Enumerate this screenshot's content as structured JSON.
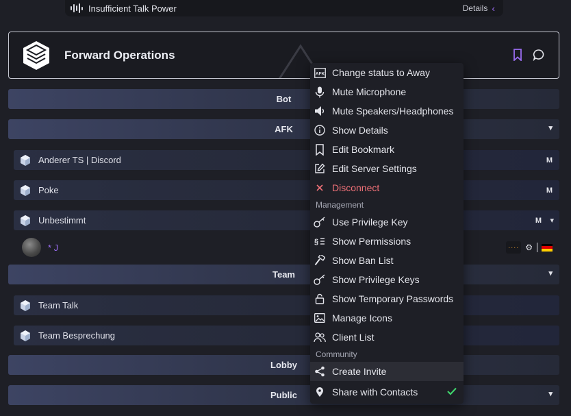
{
  "notification": {
    "title": "Insufficient Talk Power",
    "details_label": "Details"
  },
  "server": {
    "name": "Forward Operations"
  },
  "channels": {
    "bot": "Bot",
    "afk": "AFK",
    "team": "Team",
    "lobby": "Lobby",
    "public": "Public"
  },
  "subchannels": [
    {
      "name": "Anderer TS | Discord",
      "badge": "M"
    },
    {
      "name": "Poke",
      "badge": "M"
    },
    {
      "name": "Unbestimmt",
      "badge": "M"
    },
    {
      "name": "Team Talk"
    },
    {
      "name": "Team Besprechung"
    }
  ],
  "client": {
    "name": "* J"
  },
  "menu": {
    "items_top": [
      {
        "label": "Change status to Away",
        "icon": "afk-icon"
      },
      {
        "label": "Mute Microphone",
        "icon": "microphone-icon"
      },
      {
        "label": "Mute Speakers/Headphones",
        "icon": "speaker-icon"
      },
      {
        "label": "Show Details",
        "icon": "info-icon"
      },
      {
        "label": "Edit Bookmark",
        "icon": "bookmark-icon"
      },
      {
        "label": "Edit Server Settings",
        "icon": "edit-icon"
      },
      {
        "label": "Disconnect",
        "icon": "close-icon"
      }
    ],
    "section_management": "Management",
    "items_management": [
      {
        "label": "Use Privilege Key",
        "icon": "key-icon"
      },
      {
        "label": "Show Permissions",
        "icon": "permissions-icon"
      },
      {
        "label": "Show Ban List",
        "icon": "hammer-icon"
      },
      {
        "label": "Show Privilege Keys",
        "icon": "key-icon"
      },
      {
        "label": "Show Temporary Passwords",
        "icon": "lock-icon"
      },
      {
        "label": "Manage Icons",
        "icon": "image-icon"
      },
      {
        "label": "Client List",
        "icon": "users-icon"
      }
    ],
    "section_community": "Community",
    "items_community": [
      {
        "label": "Create Invite",
        "icon": "share-icon"
      },
      {
        "label": "Share with Contacts",
        "icon": "location-icon",
        "checked": true
      }
    ]
  },
  "colors": {
    "accent": "#9a6cf0",
    "danger": "#f07178",
    "check": "#3ecf6a",
    "background": "#1e1f26"
  }
}
